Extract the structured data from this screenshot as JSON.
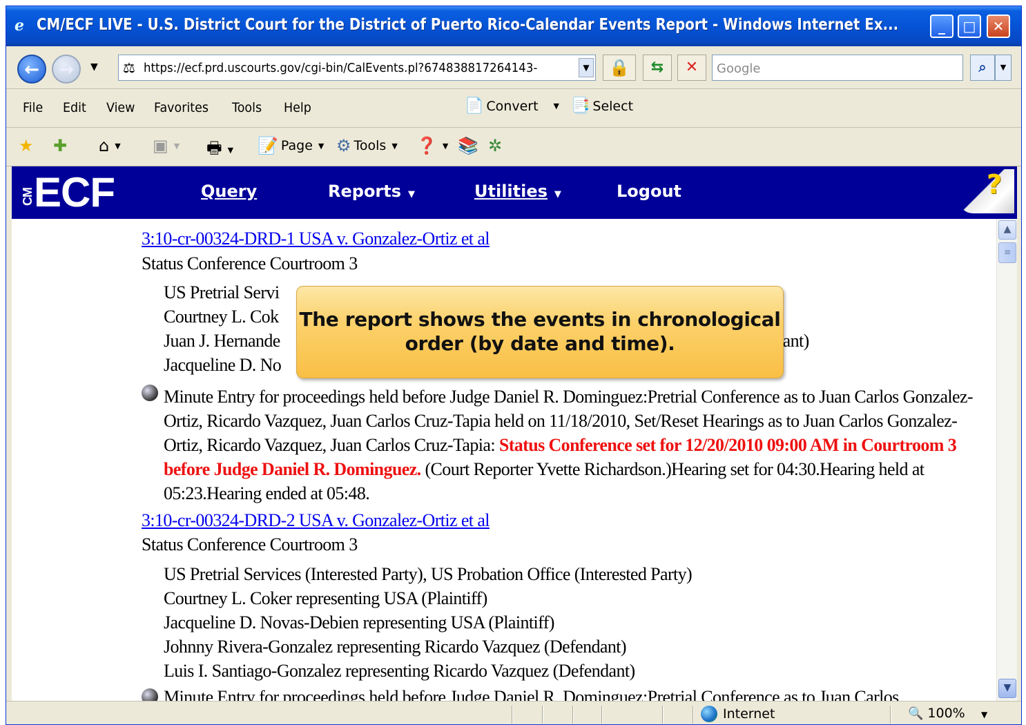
{
  "window": {
    "title": "CM/ECF LIVE - U.S. District Court for the District of Puerto Rico-Calendar Events Report - Windows Internet Ex...",
    "min_glyph": "_",
    "max_glyph": "□",
    "close_glyph": "✕"
  },
  "address_bar": {
    "url": "https://ecf.prd.uscourts.gov/cgi-bin/CalEvents.pl?674838817264143-",
    "search_placeholder": "Google"
  },
  "menu": {
    "items": [
      "File",
      "Edit",
      "View",
      "Favorites",
      "Tools",
      "Help"
    ],
    "convert_label": "Convert",
    "select_label": "Select"
  },
  "command_bar": {
    "page_label": "Page",
    "tools_label": "Tools"
  },
  "ecf_nav": {
    "logo_text": "ECF",
    "logo_small": "CM",
    "items": [
      {
        "label": "Query",
        "has_dropdown": false
      },
      {
        "label": "Reports",
        "has_dropdown": true
      },
      {
        "label": "Utilities",
        "has_dropdown": true
      },
      {
        "label": "Logout",
        "has_dropdown": false
      }
    ],
    "help_glyph": "?"
  },
  "report": {
    "case1": {
      "link": "3:10-cr-00324-DRD-1 USA v. Gonzalez-Ortiz et al",
      "event": "Status Conference Courtroom 3",
      "parties_visible": [
        "US Pretrial Servi",
        "Courtney L. Cok",
        "Juan J. Hernande",
        "Jacqueline D. No"
      ],
      "party3_tail": "lant)"
    },
    "minute_entry": {
      "text_before": "Minute Entry for proceedings held before Judge Daniel R. Dominguez:Pretrial Conference as to Juan Carlos Gonzalez-Ortiz, Ricardo Vazquez, Juan Carlos Cruz-Tapia held on 11/18/2010, Set/Reset Hearings as to Juan Carlos Gonzalez-Ortiz, Ricardo Vazquez, Juan Carlos Cruz-Tapia: ",
      "highlight": "Status Conference set for 12/20/2010 09:00 AM in Courtroom 3 before Judge Daniel R. Dominguez.",
      "text_after": " (Court Reporter Yvette Richardson.)Hearing set for 04:30.Hearing held at 05:23.Hearing ended at 05:48."
    },
    "case2": {
      "link": "3:10-cr-00324-DRD-2 USA v. Gonzalez-Ortiz et al",
      "event": "Status Conference Courtroom 3",
      "parties": [
        "US Pretrial Services (Interested Party), US Probation Office (Interested Party)",
        "Courtney L. Coker representing USA (Plaintiff)",
        "Jacqueline D. Novas-Debien representing USA (Plaintiff)",
        "Johnny Rivera-Gonzalez representing Ricardo Vazquez (Defendant)",
        "Luis I. Santiago-Gonzalez representing Ricardo Vazquez (Defendant)"
      ]
    },
    "cut_off_line": "Minute Entry for proceedings held before Judge Daniel R. Dominguez:Pretrial Conference as to Juan Carlos"
  },
  "callout": {
    "text": "The report shows the events in chronological order (by date and time)."
  },
  "status_bar": {
    "zone": "Internet",
    "zoom": "100%"
  }
}
